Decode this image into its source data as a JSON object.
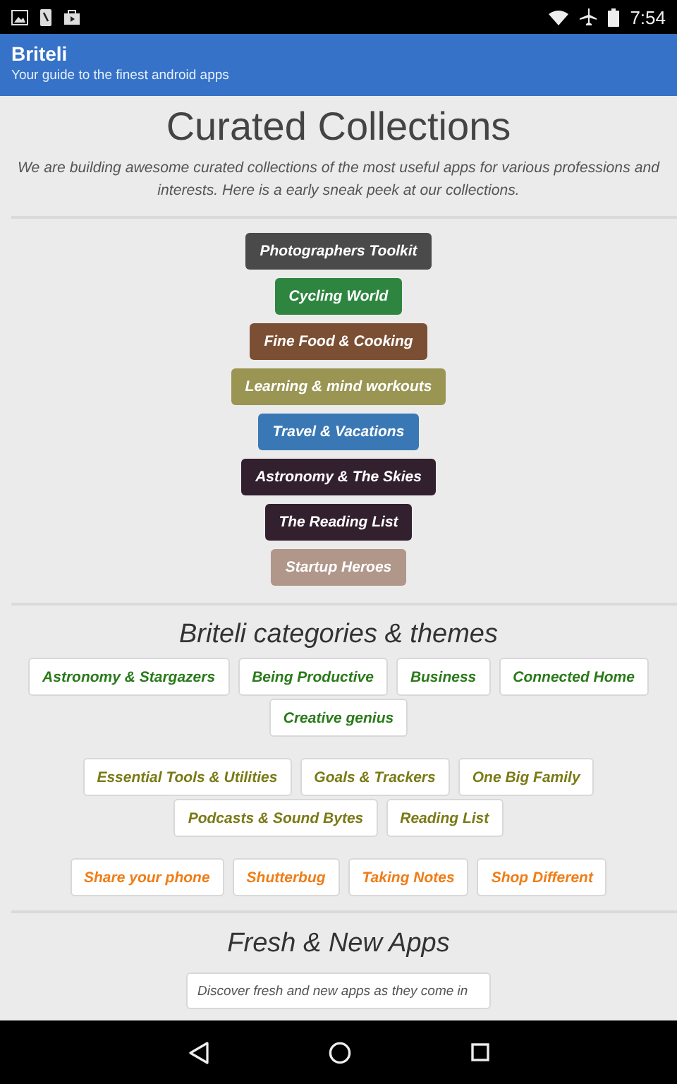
{
  "status_bar": {
    "time": "7:54"
  },
  "app_bar": {
    "title": "Briteli",
    "subtitle": "Your guide to the finest android apps"
  },
  "collections": {
    "title": "Curated Collections",
    "intro": "We are building awesome curated collections of the most useful apps for various professions and interests. Here is a early sneak peek at our collections.",
    "items": [
      {
        "label": "Photographers Toolkit",
        "color": "#4a4a4a"
      },
      {
        "label": "Cycling World",
        "color": "#2e8540"
      },
      {
        "label": "Fine Food & Cooking",
        "color": "#7b4f33"
      },
      {
        "label": "Learning & mind workouts",
        "color": "#9a9553"
      },
      {
        "label": "Travel & Vacations",
        "color": "#3a78b5"
      },
      {
        "label": "Astronomy & The Skies",
        "color": "#33202f"
      },
      {
        "label": "The Reading List",
        "color": "#33202f"
      },
      {
        "label": "Startup Heroes",
        "color": "#b0978a"
      }
    ]
  },
  "categories": {
    "title": "Briteli categories & themes",
    "groups": [
      {
        "color": "#2a7a1a",
        "items": [
          "Astronomy & Stargazers",
          "Being Productive",
          "Business",
          "Connected Home",
          "Creative genius"
        ]
      },
      {
        "color": "#7a7a16",
        "items": [
          "Essential Tools & Utilities",
          "Goals & Trackers",
          "One Big Family",
          "Podcasts & Sound Bytes",
          "Reading List"
        ]
      },
      {
        "color": "#f07d17",
        "items": [
          "Share your phone",
          "Shutterbug",
          "Taking Notes",
          "Shop Different"
        ]
      }
    ]
  },
  "fresh": {
    "title": "Fresh & New Apps",
    "field": {
      "placeholder": "Discover fresh and new apps as they come in"
    }
  }
}
